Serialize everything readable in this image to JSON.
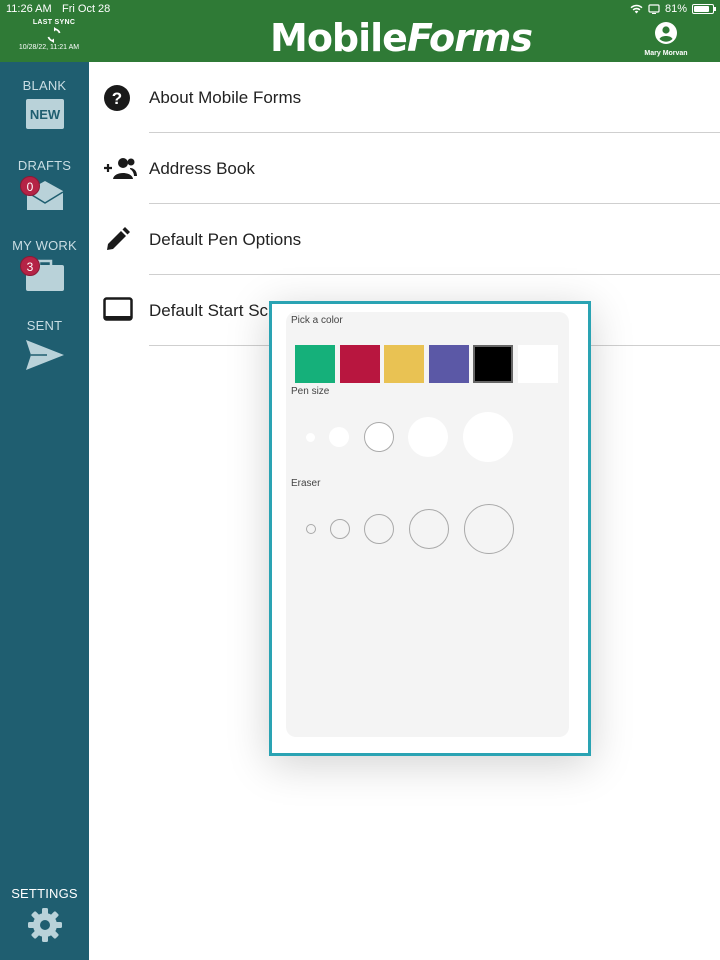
{
  "status_bar": {
    "time": "11:26 AM",
    "date": "Fri Oct 28",
    "battery": "81%",
    "battery_level": 0.81
  },
  "sync": {
    "label": "LAST SYNC",
    "timestamp": "10/28/22, 11:21 AM"
  },
  "app": {
    "logo_part1": "Mobile",
    "logo_part2": "Forms"
  },
  "user": {
    "name": "Mary Morvan"
  },
  "sidebar": {
    "items": [
      {
        "label": "BLANK",
        "icon": "new-icon",
        "icon_text": "NEW"
      },
      {
        "label": "DRAFTS",
        "icon": "envelope-icon",
        "badge": "0"
      },
      {
        "label": "MY WORK",
        "icon": "briefcase-icon",
        "badge": "3"
      },
      {
        "label": "SENT",
        "icon": "send-icon"
      }
    ],
    "settings_label": "SETTINGS"
  },
  "settings_list": [
    {
      "label": "About Mobile Forms",
      "icon": "help-circle-icon"
    },
    {
      "label": "Address Book",
      "icon": "add-person-icon"
    },
    {
      "label": "Default Pen Options",
      "icon": "pencil-icon"
    },
    {
      "label": "Default Start Screen",
      "icon": "tablet-icon"
    }
  ],
  "pen_popover": {
    "color_title": "Pick a color",
    "colors": [
      "#15b07a",
      "#b8163f",
      "#e9c253",
      "#5b58a6",
      "#000000",
      "#ffffff"
    ],
    "selected_color_index": 4,
    "pen_size_title": "Pen size",
    "eraser_title": "Eraser"
  }
}
